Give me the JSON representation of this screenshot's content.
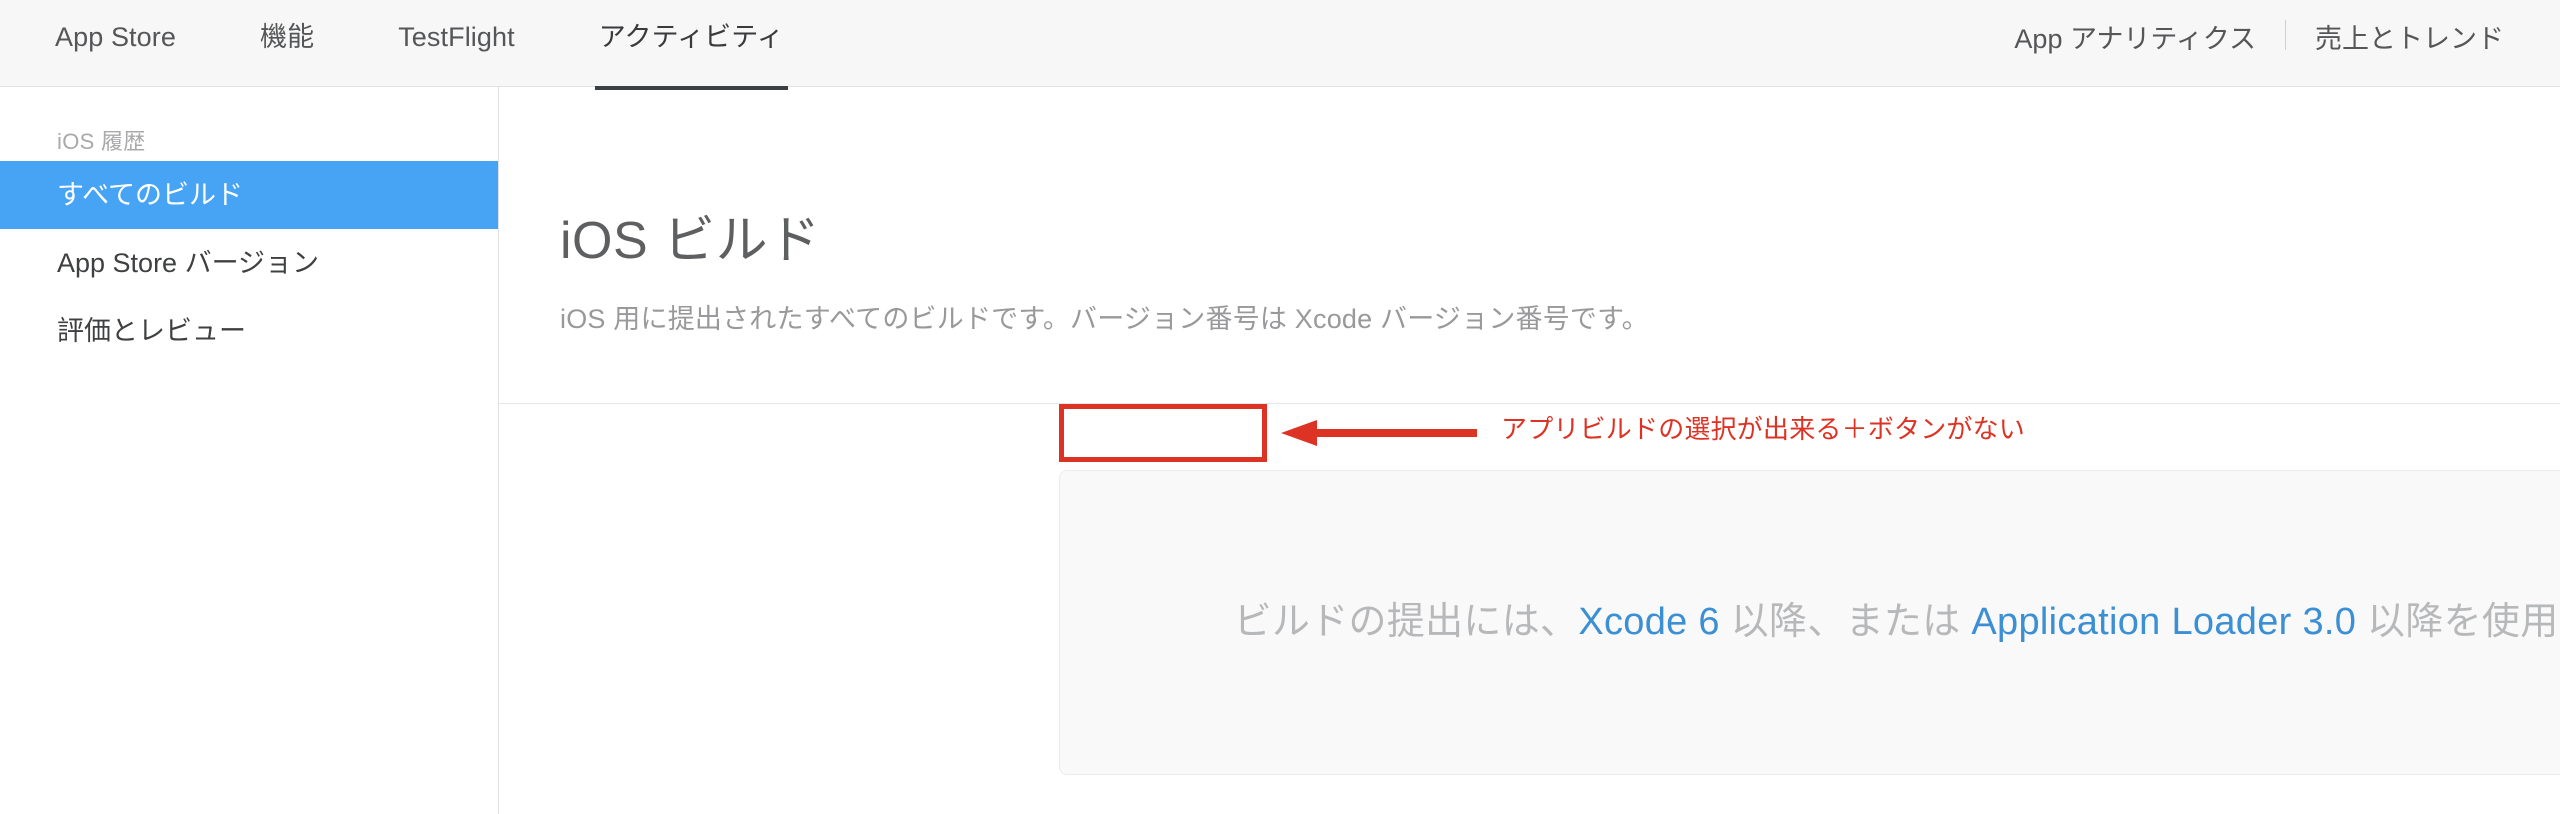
{
  "topnav": {
    "tabs": [
      {
        "label": "App Store",
        "active": false
      },
      {
        "label": "機能",
        "active": false
      },
      {
        "label": "TestFlight",
        "active": false
      },
      {
        "label": "アクティビティ",
        "active": true
      }
    ],
    "right_links": [
      {
        "label": "App アナリティクス"
      },
      {
        "label": "売上とトレンド"
      }
    ]
  },
  "sidebar": {
    "heading": "iOS 履歴",
    "items": [
      {
        "label": "すべてのビルド",
        "selected": true
      },
      {
        "label": "App Store バージョン",
        "selected": false
      },
      {
        "label": "評価とレビュー",
        "selected": false
      }
    ]
  },
  "main": {
    "title": "iOS ビルド",
    "subtitle": "iOS 用に提出されたすべてのビルドです。バージョン番号は Xcode バージョン番号です。",
    "empty_state": {
      "text_part1": "ビルドの提出には、",
      "link1": "Xcode 6",
      "text_part2": " 以降、または ",
      "link2": "Application Loader 3.0",
      "text_part3": " 以降を使用してください。"
    }
  },
  "annotation": {
    "text": "アプリビルドの選択が出来る＋ボタンがない",
    "color": "#dd3324",
    "arrow_direction": "left"
  },
  "colors": {
    "accent_blue": "#47a3f3",
    "link_blue": "#3b8fd4",
    "annotation_red": "#dd3324",
    "nav_bg": "#f7f7f7",
    "panel_bg": "#f9f9f9"
  }
}
